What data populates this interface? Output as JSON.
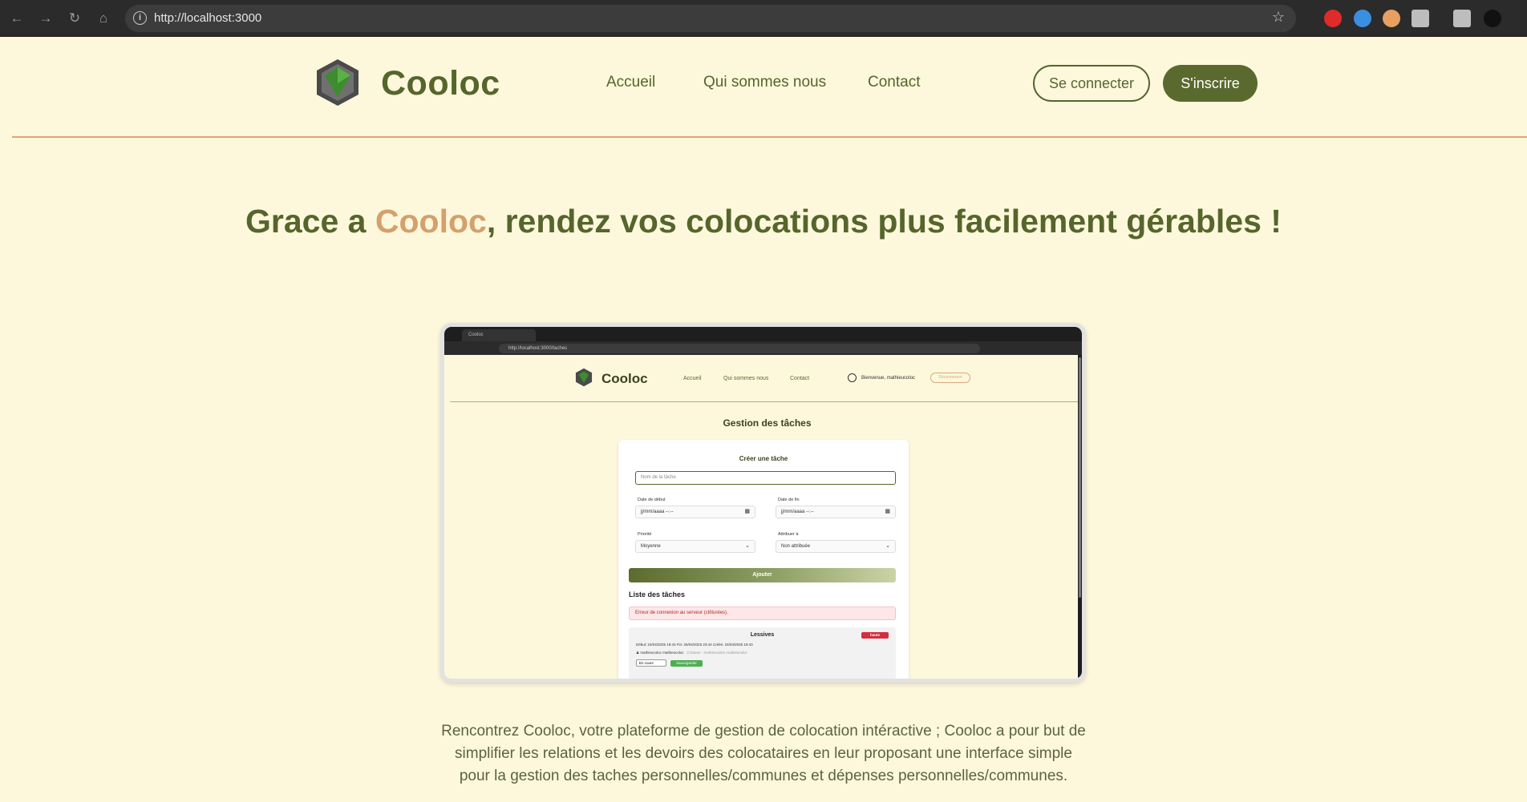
{
  "browser": {
    "url": "http://localhost:3000",
    "ext_colors": [
      "#e02b2b",
      "#3a8fe0",
      "#e8a060",
      "#bdbdbd",
      "#bdbdbd",
      "#111111"
    ]
  },
  "site": {
    "brand": "Cooloc",
    "nav": [
      "Accueil",
      "Qui sommes nous",
      "Contact"
    ],
    "login_label": "Se connecter",
    "signup_label": "S'inscrire",
    "colors": {
      "primary": "#56652c",
      "accent": "#d4a06b",
      "background": "#fdf8dc"
    }
  },
  "hero": {
    "prefix": "Grace a ",
    "accent": "Cooloc",
    "suffix": ", rendez vos colocations plus facilement gérables !"
  },
  "embedded_screenshot": {
    "tab_title": "Cooloc",
    "url": "http://localhost:3000/taches",
    "brand": "Cooloc",
    "nav": [
      "Accueil",
      "Qui sommes nous",
      "Contact"
    ],
    "welcome": "Bienvenue, mathieucoloc",
    "logout": "Déconnexion",
    "page_title": "Gestion des tâches",
    "form": {
      "title": "Créer une tâche",
      "name_placeholder": "Nom de la tâche",
      "start_label": "Date de début",
      "end_label": "Date de fin",
      "date_placeholder": "jj/mm/aaaa --:--",
      "priority_label": "Priorité",
      "priority_value": "Moyenne",
      "assign_label": "Attribuer à",
      "assign_value": "Non attribuée",
      "add_label": "Ajouter"
    },
    "list_title": "Liste des tâches",
    "error": "Erreur de connexion au serveur (clôturées).",
    "task": {
      "name": "Lessives",
      "priority": "haute",
      "dates": "Début: 24/04/2025 19:43    Fin: 25/04/2025 23:44    Créée: 24/04/2025 19:43",
      "assignee": "mathieucoloc mathieucoloc",
      "creator": "Créateur : mathieucoloc mathieucoloc",
      "status": "En cours",
      "save": "Sauvegarder"
    }
  },
  "description": "Rencontrez Cooloc, votre plateforme de gestion de colocation intéractive ; Cooloc a pour but de simplifier les relations et les devoirs des colocataires en leur proposant une interface simple pour la gestion des taches personnelles/communes et dépenses personnelles/communes."
}
